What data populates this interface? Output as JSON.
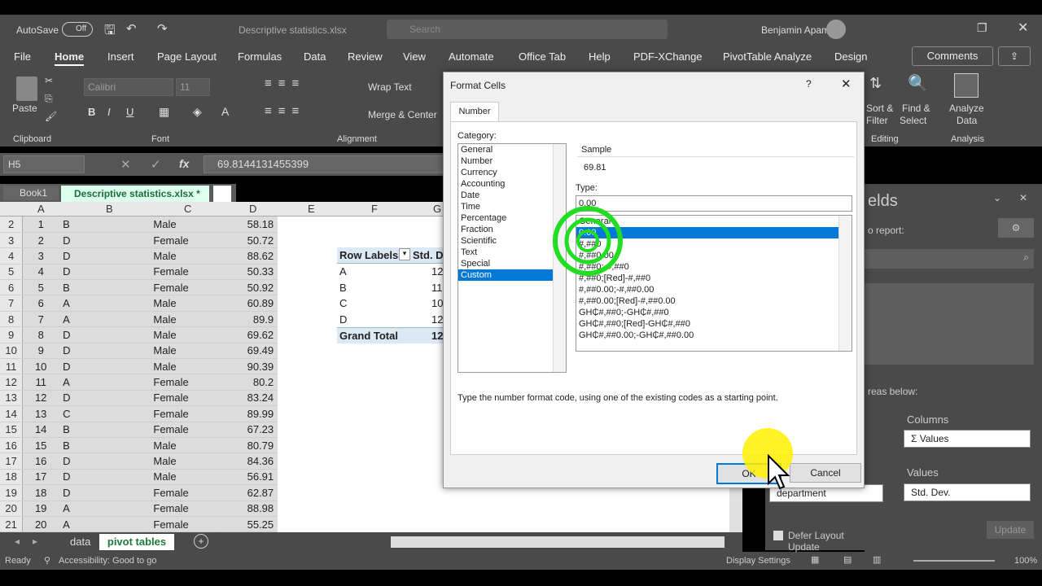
{
  "titlebar": {
    "autosave": "AutoSave",
    "autosave_state": "Off",
    "filename": "Descriptive statistics.xlsx",
    "search": "Search",
    "user": "Benjamin Apam"
  },
  "ribbon_tabs": [
    "File",
    "Home",
    "Insert",
    "Page Layout",
    "Formulas",
    "Data",
    "Review",
    "View",
    "Automate",
    "Office Tab",
    "Help",
    "PDF-XChange",
    "PivotTable Analyze",
    "Design"
  ],
  "comments_label": "Comments",
  "ribbon": {
    "clipboard": "Clipboard",
    "paste": "Paste",
    "font": "Font",
    "font_name": "Calibri",
    "font_size": "11",
    "alignment": "Alignment",
    "wrap": "Wrap Text",
    "merge": "Merge & Center",
    "editing": "Editing",
    "sort": "Sort &",
    "filter": "Filter",
    "find": "Find &",
    "select": "Select",
    "analyze": "Analyze",
    "data_label": "Data",
    "analysis": "Analysis"
  },
  "formula": {
    "cell": "H5",
    "fx": "fx",
    "value": "69.8144131455399"
  },
  "book_tabs": [
    "Book1",
    "Descriptive statistics.xlsx *"
  ],
  "columns": [
    "A",
    "B",
    "C",
    "D",
    "E",
    "F",
    "G"
  ],
  "rows": [
    [
      "2",
      "1",
      "B",
      "Male",
      "58.18"
    ],
    [
      "3",
      "2",
      "D",
      "Female",
      "50.72"
    ],
    [
      "4",
      "3",
      "D",
      "Male",
      "88.62"
    ],
    [
      "5",
      "4",
      "D",
      "Female",
      "50.33"
    ],
    [
      "6",
      "5",
      "B",
      "Female",
      "50.92"
    ],
    [
      "7",
      "6",
      "A",
      "Male",
      "60.89"
    ],
    [
      "8",
      "7",
      "A",
      "Male",
      "89.9"
    ],
    [
      "9",
      "8",
      "D",
      "Male",
      "69.62"
    ],
    [
      "10",
      "9",
      "D",
      "Male",
      "69.49"
    ],
    [
      "11",
      "10",
      "D",
      "Male",
      "90.39"
    ],
    [
      "12",
      "11",
      "A",
      "Female",
      "80.2"
    ],
    [
      "13",
      "12",
      "D",
      "Female",
      "83.24"
    ],
    [
      "14",
      "13",
      "C",
      "Female",
      "89.99"
    ],
    [
      "15",
      "14",
      "B",
      "Female",
      "67.23"
    ],
    [
      "16",
      "15",
      "B",
      "Male",
      "80.79"
    ],
    [
      "17",
      "16",
      "D",
      "Male",
      "84.36"
    ],
    [
      "18",
      "17",
      "D",
      "Male",
      "56.91"
    ],
    [
      "19",
      "18",
      "D",
      "Female",
      "62.87"
    ],
    [
      "20",
      "19",
      "A",
      "Female",
      "88.98"
    ],
    [
      "21",
      "20",
      "A",
      "Female",
      "55.25"
    ]
  ],
  "pivot": {
    "header1": "Row Labels",
    "header2": "Std. D",
    "rows": [
      [
        "A",
        "12"
      ],
      [
        "B",
        "11"
      ],
      [
        "C",
        "10"
      ],
      [
        "D",
        "12"
      ]
    ],
    "total": "Grand Total",
    "total_val": "12"
  },
  "sheet_tabs": [
    "data",
    "pivot tables"
  ],
  "status": {
    "ready": "Ready",
    "accessibility": "Accessibility: Good to go",
    "display": "Display Settings",
    "zoom": "100%"
  },
  "dialog": {
    "title": "Format Cells",
    "help": "?",
    "tab": "Number",
    "category_label": "Category:",
    "categories": [
      "General",
      "Number",
      "Currency",
      "Accounting",
      "Date",
      "Time",
      "Percentage",
      "Fraction",
      "Scientific",
      "Text",
      "Special",
      "Custom"
    ],
    "selected_category": "Custom",
    "sample_label": "Sample",
    "sample_value": "69.81",
    "type_label": "Type:",
    "type_value": "0.00",
    "types": [
      "General",
      "0.00",
      "#,##0",
      "#,##0.00",
      "#,##0;-#,##0",
      "#,##0;[Red]-#,##0",
      "#,##0.00;-#,##0.00",
      "#,##0.00;[Red]-#,##0.00",
      "GH₵#,##0;-GH₵#,##0",
      "GH₵#,##0;[Red]-GH₵#,##0",
      "GH₵#,##0.00;-GH₵#,##0.00"
    ],
    "hint": "Type the number format code, using one of the existing codes as a starting point.",
    "ok": "OK",
    "cancel": "Cancel"
  },
  "pivot_pane": {
    "title": "elds",
    "report": "o report:",
    "areas": "reas below:",
    "columns": "Columns",
    "values_label": "Values",
    "columns_field": "Σ Values",
    "rows_field": "department",
    "values_field": "Std. Dev.",
    "defer": "Defer Layout Update",
    "update": "Update"
  }
}
